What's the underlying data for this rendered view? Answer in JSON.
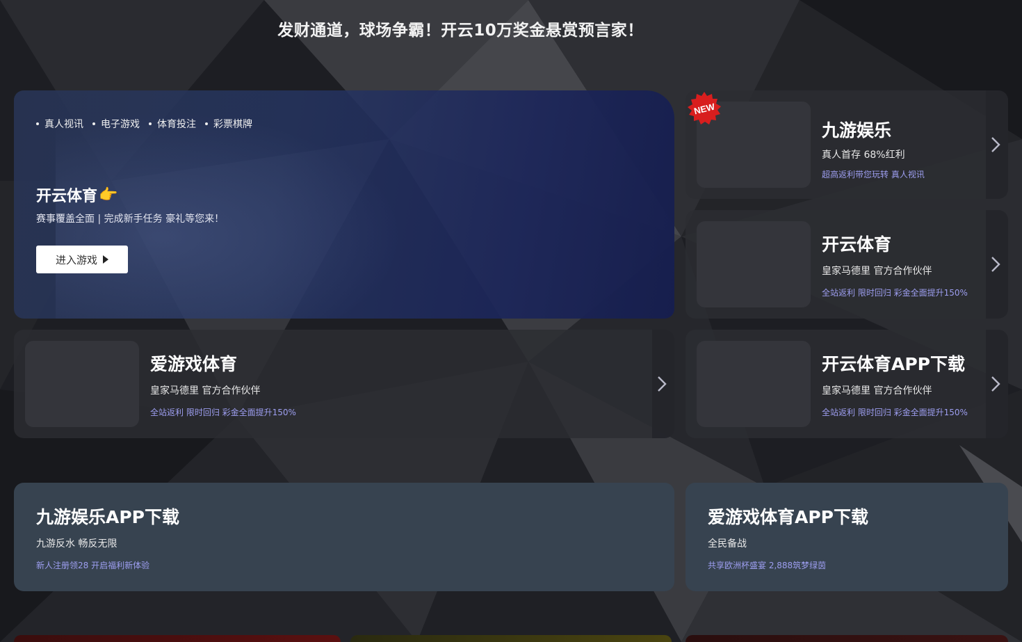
{
  "headline": "发财通道，球场争霸！开云10万奖金悬赏预言家！",
  "hero": {
    "nav": [
      "真人视讯",
      "电子游戏",
      "体育投注",
      "彩票棋牌"
    ],
    "title": "开云体育",
    "emoji": "👉",
    "desc": "赛事覆盖全面 | 完成新手任务 豪礼等您来！",
    "button": "进入游戏"
  },
  "badge": "NEW",
  "side_cards": [
    {
      "title": "九游娱乐",
      "sub": "真人首存  68%红利",
      "note": "超高返利带您玩转 真人视讯"
    },
    {
      "title": "开云体育",
      "sub": "皇家马德里  官方合作伙伴",
      "note": "全站返利 限时回归 彩金全面提升150%"
    },
    {
      "title": "开云体育APP下载",
      "sub": "皇家马德里  官方合作伙伴",
      "note": "全站返利 限时回归 彩金全面提升150%"
    }
  ],
  "wide_card": {
    "title": "爱游戏体育",
    "sub": "皇家马德里  官方合作伙伴",
    "note": "全站返利 限时回归 彩金全面提升150%"
  },
  "app_cards": [
    {
      "title": "九游娱乐APP下载",
      "sub": "九游反水 畅反无限",
      "note": "新人注册领28 开启福利新体验"
    },
    {
      "title": "爱游戏体育APP下载",
      "sub": "全民备战",
      "note": "共享欧洲杯盛宴 2,888筑梦绿茵"
    }
  ],
  "colors": {
    "accent_note": "#9d9ef0",
    "badge_red": "#d81e1e",
    "slate": "#374350"
  }
}
